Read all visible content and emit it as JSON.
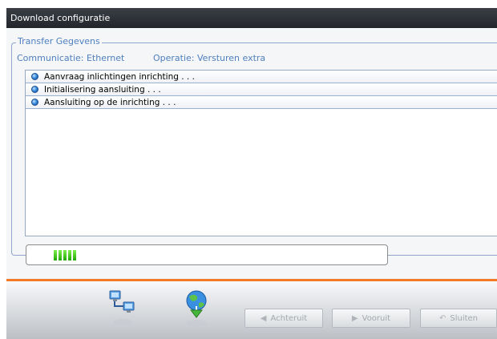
{
  "window": {
    "title": "Download configuratie"
  },
  "transfer": {
    "group_label": "Transfer Gegevens",
    "communication": "Communicatie: Ethernet",
    "operation": "Operatie: Versturen extra"
  },
  "log": {
    "items": [
      {
        "text": "Aanvraag inlichtingen inrichting . . ."
      },
      {
        "text": "Initialisering aansluiting . . ."
      },
      {
        "text": "Aansluiting op de inrichting . . ."
      }
    ]
  },
  "progress": {
    "filled_segments": 5,
    "color": "#28b30a"
  },
  "footer": {
    "icons": [
      "network-computers-icon",
      "globe-download-icon"
    ],
    "back_label": "Achteruit",
    "next_label": "Vooruit",
    "close_label": "Sluiten"
  },
  "colors": {
    "accent_orange": "#f07a25",
    "label_blue": "#4f7fbf",
    "title_bar": "#2c3036"
  }
}
